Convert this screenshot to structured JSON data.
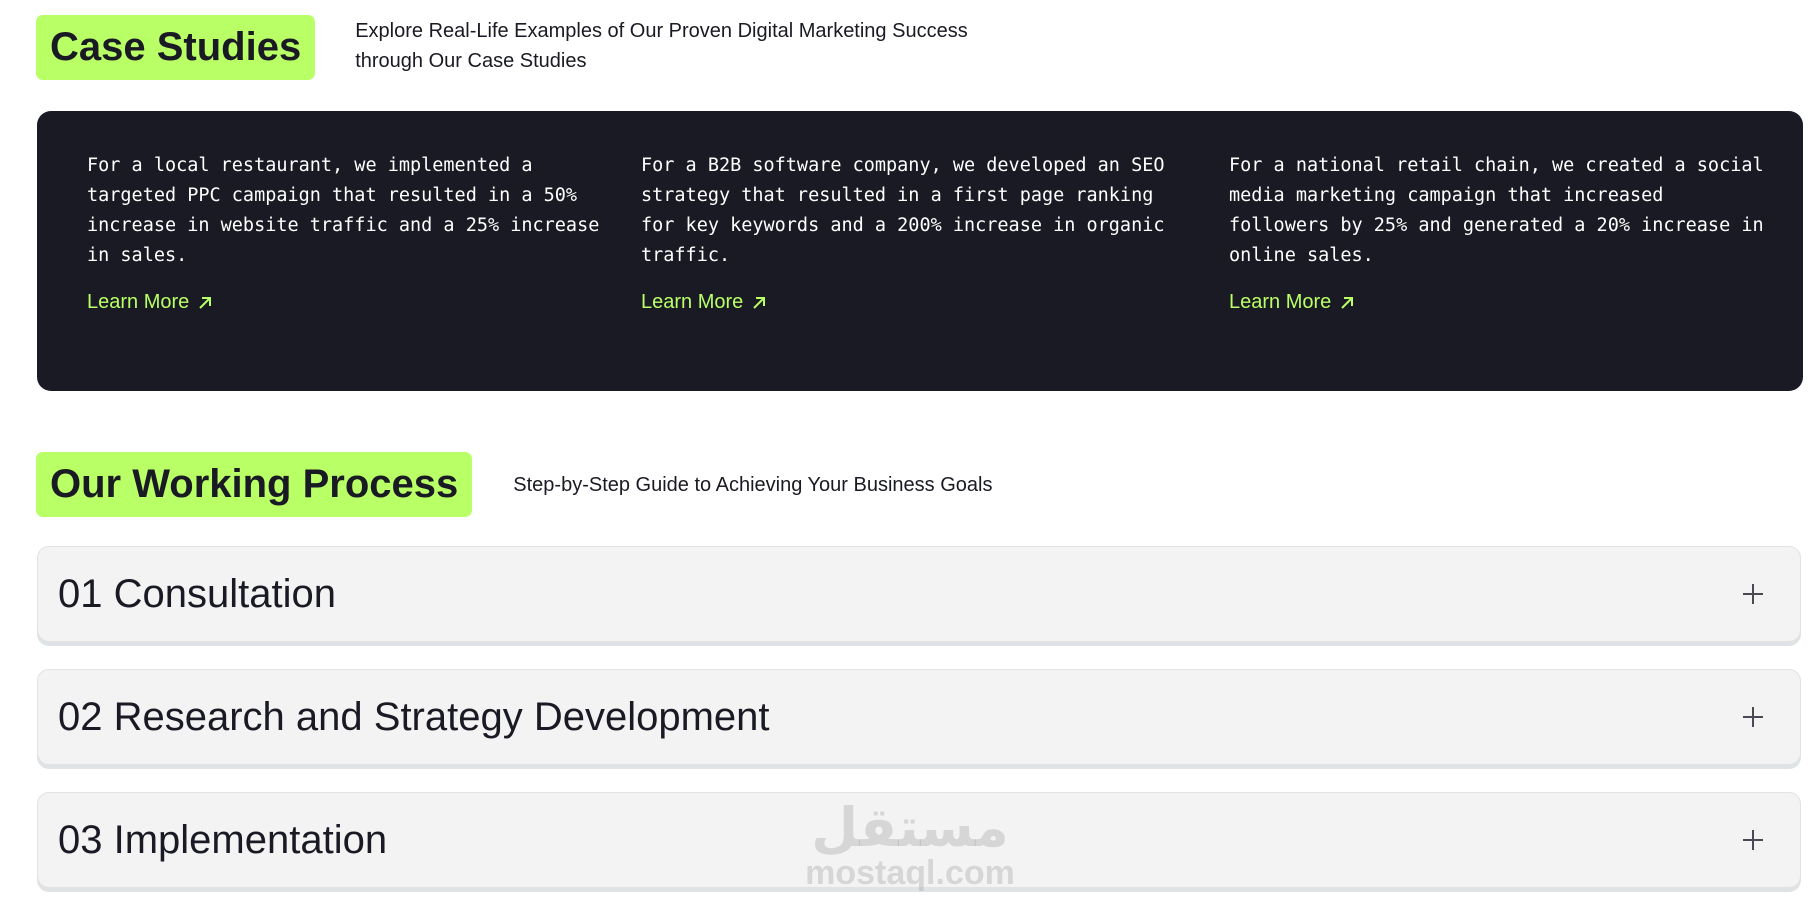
{
  "case_studies": {
    "title": "Case Studies",
    "subtitle": "Explore Real-Life Examples of Our Proven Digital Marketing Success through Our Case Studies",
    "items": [
      {
        "text": "For a local restaurant, we implemented a targeted PPC campaign that resulted in a 50% increase in website traffic and a 25% increase in sales.",
        "link_label": "Learn More"
      },
      {
        "text": "For a B2B software company, we developed an SEO strategy that resulted in a first page ranking for key keywords and a 200% increase in organic traffic.",
        "link_label": "Learn More"
      },
      {
        "text": "For a national retail chain, we created a social media marketing campaign that increased followers by 25% and generated a 20% increase in online sales.",
        "link_label": "Learn More"
      }
    ]
  },
  "working_process": {
    "title": "Our Working Process",
    "subtitle": "Step-by-Step Guide to Achieving Your Business Goals",
    "steps": [
      {
        "label": "01 Consultation",
        "toggle_icon": "plus-icon"
      },
      {
        "label": "02 Research and Strategy Development",
        "toggle_icon": "plus-icon"
      },
      {
        "label": "03 Implementation",
        "toggle_icon": "plus-icon"
      }
    ]
  },
  "watermark": {
    "arabic": "مستقل",
    "latin": "mostaql.com"
  },
  "colors": {
    "accent": "#b9ff66",
    "dark": "#191a23",
    "card_bg": "#f3f3f3"
  }
}
